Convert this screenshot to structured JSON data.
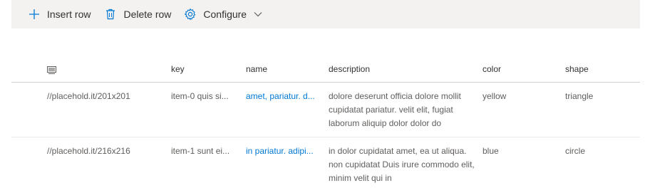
{
  "toolbar": {
    "insert_label": "Insert row",
    "delete_label": "Delete row",
    "configure_label": "Configure"
  },
  "columns": {
    "key": "key",
    "name": "name",
    "description": "description",
    "color": "color",
    "shape": "shape"
  },
  "rows": [
    {
      "image": "//placehold.it/201x201",
      "key": "item-0 quis si...",
      "name": "amet, pariatur. d...",
      "description": "dolore deserunt officia dolore mollit cupidatat pariatur. velit elit, fugiat laborum aliquip dolor dolor do",
      "color": "yellow",
      "shape": "triangle"
    },
    {
      "image": "//placehold.it/216x216",
      "key": "item-1 sunt ei...",
      "name": "in pariatur. adipi...",
      "description": "in dolor cupidatat amet, ea ut aliqua. non cupidatat Duis irure commodo elit, minim velit qui in",
      "color": "blue",
      "shape": "circle"
    }
  ],
  "colors": {
    "toolbar_bg": "#f3f2f1",
    "accent": "#0078d4",
    "text": "#323130",
    "muted_text": "#605e5c"
  },
  "icons": {
    "insert": "plus-icon",
    "delete": "trash-icon",
    "configure": "gear-icon",
    "configure_menu": "chevron-down-icon",
    "image_column": "image-icon"
  }
}
